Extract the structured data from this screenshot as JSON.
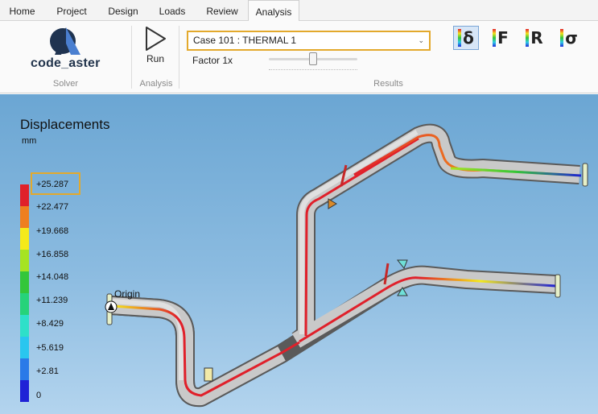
{
  "tabs": [
    {
      "label": "Home",
      "active": false
    },
    {
      "label": "Project",
      "active": false
    },
    {
      "label": "Design",
      "active": false
    },
    {
      "label": "Loads",
      "active": false
    },
    {
      "label": "Review",
      "active": false
    },
    {
      "label": "Analysis",
      "active": true
    }
  ],
  "ribbon": {
    "solver": {
      "logo_text": "code_aster",
      "group_label": "Solver"
    },
    "analysis": {
      "run_label": "Run",
      "group_label": "Analysis"
    },
    "results": {
      "case_value": "Case 101 : THERMAL 1",
      "factor_label": "Factor 1x",
      "factor_value": 0.5,
      "group_label": "Results",
      "buttons": [
        {
          "symbol": "δ",
          "icon": "displacement-icon",
          "selected": true
        },
        {
          "symbol": "F",
          "icon": "force-icon",
          "selected": false
        },
        {
          "symbol": "R",
          "icon": "reaction-icon",
          "selected": false
        },
        {
          "symbol": "σ",
          "icon": "stress-icon",
          "selected": false
        }
      ]
    }
  },
  "viewport": {
    "legend_title": "Displacements",
    "unit": "mm",
    "ticks": [
      "+25.287",
      "+22.477",
      "+19.668",
      "+16.858",
      "+14.048",
      "+11.239",
      "+8.429",
      "+5.619",
      "+2.81",
      "0"
    ],
    "colors": [
      "#e0202a",
      "#ee7f1f",
      "#f5ea1a",
      "#a6e322",
      "#33c63a",
      "#26d37a",
      "#2ee0c9",
      "#29c6ef",
      "#2a7ae8",
      "#1f22d6"
    ],
    "origin_label": "Origin"
  }
}
